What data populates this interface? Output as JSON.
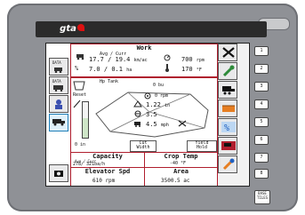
{
  "brand": {
    "logo_text": "gta"
  },
  "left_panel": {
    "button_labels": [
      "DATA",
      "DATA",
      "",
      ""
    ]
  },
  "work_panel": {
    "title": "Work",
    "avg_curr_label": "Avg / Curr",
    "speed": {
      "avg": "17.7",
      "curr": "19.4",
      "unit": "km/ac"
    },
    "rpm": {
      "value": "700",
      "unit": "rpm"
    },
    "area_rate": {
      "avg": "7.0",
      "curr": "0.1",
      "unit": "ha"
    },
    "temp": {
      "value": "170",
      "unit": "°F"
    }
  },
  "header_panel": {
    "title": "Hp Tank",
    "fill_value": "0",
    "fill_unit": "bu",
    "reset_label": "Reset",
    "rpm_value": "0",
    "rpm_unit": "rpm",
    "height_value": "1.22",
    "height_unit": "in",
    "reel_value": "3.5",
    "ground_speed_value": "4.5",
    "ground_speed_unit": "mph",
    "meter_value": "0",
    "meter_unit": "in",
    "cut_width_label": "Cut\nWidth",
    "yield_hold_label": "Yield\nHold"
  },
  "lower_panel": {
    "capacity_label": "Capacity",
    "capacity_sub": "Ave / Curr",
    "capacity_values": "278/  321ba/h",
    "crop_temp_label": "Crop Temp",
    "crop_temp_value": "-40 °F",
    "elevator_label": "Elevator Spd",
    "elevator_value": "610 rpm",
    "area_label": "Area",
    "area_value": "3500.5 ac"
  },
  "softkeys": {
    "labels": [
      "1",
      "2",
      "3",
      "4",
      "5",
      "6",
      "7",
      "8"
    ],
    "extra_label": "BASE\nTILES"
  },
  "colors": {
    "accent_red": "#b01e2e",
    "icon_green": "#2e8b3a",
    "icon_orange": "#e67e22",
    "icon_blue": "#2060c0"
  }
}
